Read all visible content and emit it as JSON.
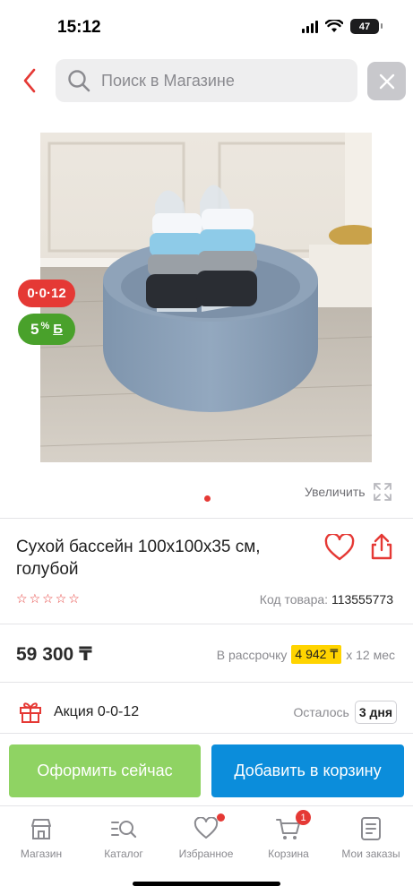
{
  "status": {
    "time": "15:12",
    "battery": "47"
  },
  "header": {
    "search_placeholder": "Поиск в Магазине"
  },
  "product": {
    "badge_installment": "0·0·12",
    "badge_bonus_value": "5",
    "badge_bonus_unit": "%",
    "badge_bonus_sign": "Б",
    "zoom_label": "Увеличить",
    "title": "Сухой бассейн 100х100х35 см, голубой",
    "rating_stars": 0,
    "sku_label": "Код товара:",
    "sku_value": "113555773",
    "price": "59 300 ₸",
    "installment_prefix": "В рассрочку",
    "installment_amount": "4 942 ₸",
    "installment_suffix": "х 12 мес"
  },
  "promo": {
    "label": "Акция 0-0-12",
    "remaining_label": "Осталось",
    "remaining_value": "3 дня"
  },
  "actions": {
    "checkout": "Оформить сейчас",
    "add_to_cart": "Добавить в корзину"
  },
  "tabs": [
    {
      "label": "Магазин",
      "icon": "store-icon"
    },
    {
      "label": "Каталог",
      "icon": "catalog-search-icon"
    },
    {
      "label": "Избранное",
      "icon": "heart-icon"
    },
    {
      "label": "Корзина",
      "icon": "cart-icon",
      "badge": "1"
    },
    {
      "label": "Мои заказы",
      "icon": "orders-icon"
    }
  ],
  "colors": {
    "accent_red": "#e53935",
    "bonus_green": "#49a12b",
    "checkout_green": "#8fd363",
    "cart_blue": "#0b8ddb",
    "installment_yellow": "#ffd400"
  }
}
